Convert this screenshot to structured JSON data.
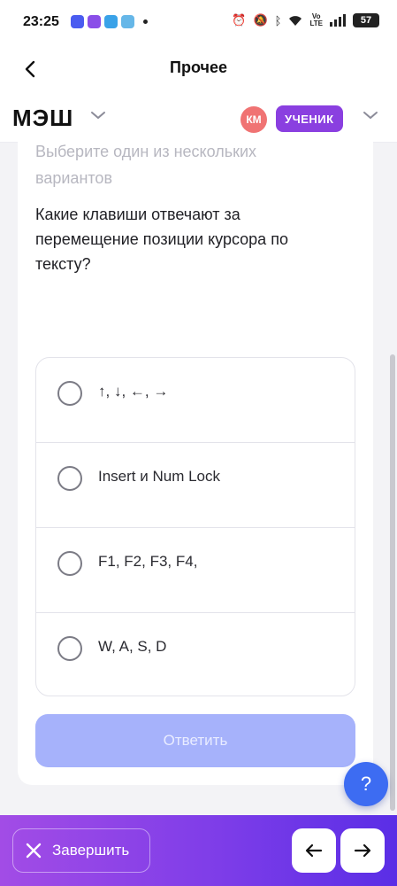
{
  "status": {
    "time": "23:25",
    "battery": "57",
    "volte_top": "Vo",
    "volte_bottom": "LTE"
  },
  "header": {
    "title": "Прочее"
  },
  "mesh": {
    "logo": "МЭШ",
    "avatar": "КМ",
    "role": "УЧЕНИК"
  },
  "card": {
    "hint": "Выберите один из нескольких вариантов",
    "question": "Какие клавиши отвечают за перемещение позиции курсора по тексту?",
    "options": [
      {
        "label": "↑,  ↓,  ←,  →",
        "selected": false
      },
      {
        "label": "Insert и Num Lock",
        "selected": false
      },
      {
        "label": "F1, F2, F3, F4,",
        "selected": false
      },
      {
        "label": "W, A, S, D",
        "selected": false
      }
    ],
    "submit": "Ответить"
  },
  "help": "?",
  "footer": {
    "finish": "Завершить"
  },
  "colors": {
    "accent_purple": "#8a3fe0",
    "submit_disabled": "#a6b2fb",
    "help_blue": "#3d6cf2",
    "avatar_red": "#f07373"
  }
}
